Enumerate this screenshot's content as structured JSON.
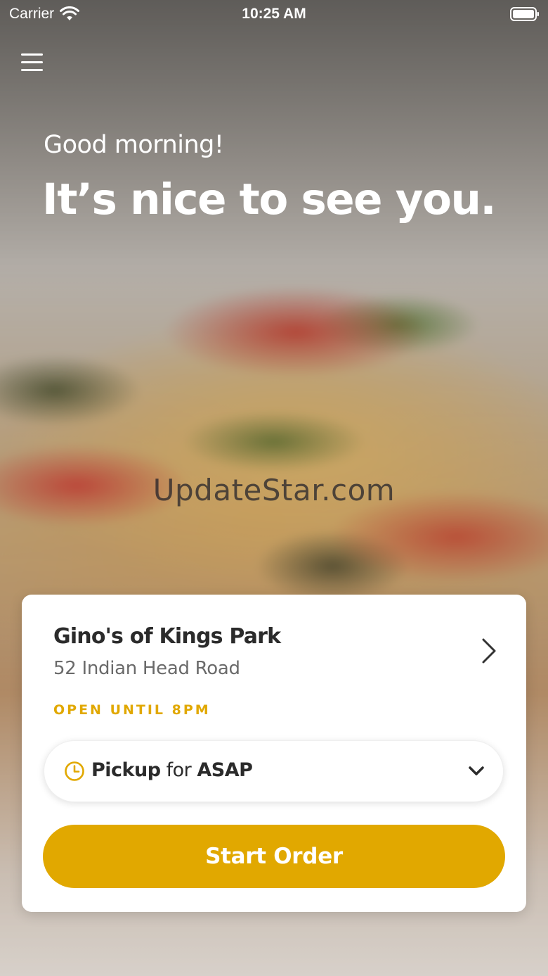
{
  "status_bar": {
    "carrier": "Carrier",
    "time": "10:25 AM",
    "wifi_icon": "wifi-icon",
    "battery_icon": "battery-full-icon"
  },
  "header": {
    "menu_icon": "hamburger-menu-icon"
  },
  "hero": {
    "greeting": "Good morning!",
    "headline": "It’s nice to see you."
  },
  "watermark": "UpdateStar.com",
  "store_card": {
    "name": "Gino's of Kings Park",
    "address": "52 Indian Head Road",
    "hours": "OPEN UNTIL 8PM",
    "order_mode": {
      "mode": "Pickup",
      "connector": "for",
      "time": "ASAP"
    },
    "start_button_label": "Start Order"
  },
  "colors": {
    "accent": "#e1a800",
    "text_dark": "#2b2b2b",
    "text_muted": "#6a6a6a"
  }
}
